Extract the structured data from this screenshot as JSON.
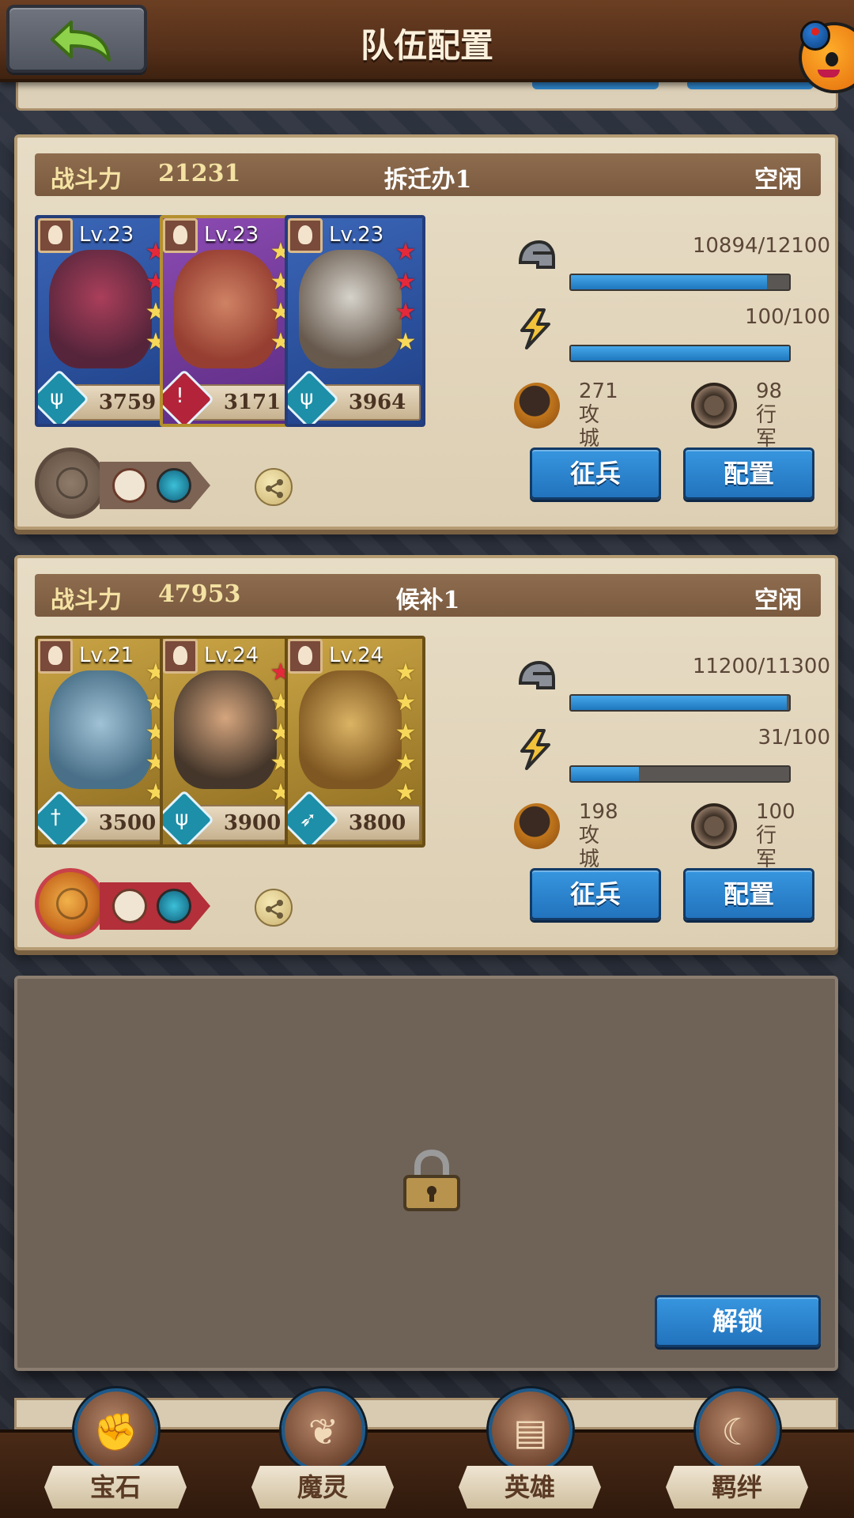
{
  "header": {
    "title": "队伍配置"
  },
  "teams": [
    {
      "power_label": "战斗力",
      "power": "21231",
      "name": "拆迁办1",
      "status": "空闲",
      "heroes": [
        {
          "level": "Lv.23",
          "power": "3759",
          "frame": "blue",
          "class_icon": "staff-class-icon",
          "stars": [
            "red",
            "red",
            "gold",
            "gold"
          ]
        },
        {
          "level": "Lv.23",
          "power": "3171",
          "frame": "purple",
          "class_icon": "warrior-class-icon",
          "stars": [
            "gold",
            "gold",
            "gold",
            "gold"
          ]
        },
        {
          "level": "Lv.23",
          "power": "3964",
          "frame": "blue",
          "class_icon": "staff-class-icon",
          "stars": [
            "red",
            "red",
            "red",
            "gold"
          ]
        }
      ],
      "troops": {
        "value": "10894/12100",
        "fraction": 0.9
      },
      "energy": {
        "value": "100/100",
        "fraction": 1.0
      },
      "siege": {
        "num": "271",
        "label": "攻城"
      },
      "march": {
        "num": "98",
        "label": "行军"
      },
      "recruit_label": "征兵",
      "config_label": "配置"
    },
    {
      "power_label": "战斗力",
      "power": "47953",
      "name": "候补1",
      "status": "空闲",
      "heroes": [
        {
          "level": "Lv.21",
          "power": "3500",
          "frame": "gold",
          "class_icon": "sword-class-icon",
          "stars": [
            "gold",
            "gold",
            "gold",
            "gold",
            "gold"
          ]
        },
        {
          "level": "Lv.24",
          "power": "3900",
          "frame": "gold",
          "class_icon": "staff-class-icon",
          "stars": [
            "red",
            "gold",
            "gold",
            "gold",
            "gold"
          ]
        },
        {
          "level": "Lv.24",
          "power": "3800",
          "frame": "gold",
          "class_icon": "bow-class-icon",
          "stars": [
            "gold",
            "gold",
            "gold",
            "gold",
            "gold"
          ]
        }
      ],
      "troops": {
        "value": "11200/11300",
        "fraction": 0.99
      },
      "energy": {
        "value": "31/100",
        "fraction": 0.31
      },
      "siege": {
        "num": "198",
        "label": "攻城"
      },
      "march": {
        "num": "100",
        "label": "行军"
      },
      "recruit_label": "征兵",
      "config_label": "配置"
    }
  ],
  "locked": {
    "unlock_label": "解锁"
  },
  "nav": [
    {
      "label": "宝石",
      "icon": "gem-icon"
    },
    {
      "label": "魔灵",
      "icon": "spirit-icon"
    },
    {
      "label": "英雄",
      "icon": "hero-book-icon"
    },
    {
      "label": "羁绊",
      "icon": "bond-icon"
    }
  ],
  "colors": {
    "accent_blue": "#2f86cc",
    "star_gold": "#f7d85a",
    "star_red": "#e4293a",
    "header_brown": "#56301a"
  }
}
